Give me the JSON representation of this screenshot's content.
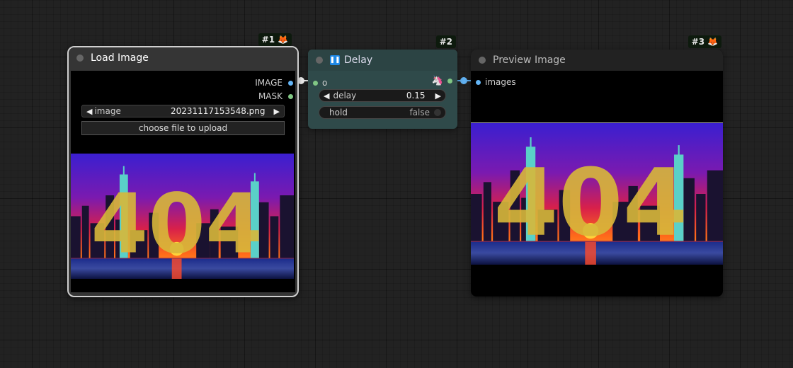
{
  "nodes": {
    "load_image": {
      "id": "#1",
      "title": "Load Image",
      "outputs": [
        "IMAGE",
        "MASK"
      ],
      "image_widget": {
        "label": "image",
        "value": "20231117153548.png"
      },
      "upload_button": "choose file to upload"
    },
    "delay": {
      "id": "#2",
      "title": "Delay",
      "input": "o",
      "delay_widget": {
        "label": "delay",
        "value": "0.15"
      },
      "hold_widget": {
        "label": "hold",
        "value": "false"
      }
    },
    "preview_image": {
      "id": "#3",
      "title": "Preview Image",
      "input": "images"
    }
  },
  "image_text": "404",
  "colors": {
    "image_slot": "#64b5f6",
    "mask_slot": "#81c784",
    "delay_node_bg": "#2f4a4a",
    "node_bg": "#353535",
    "node_header": "#222222",
    "selected_outline": "#cfcfcf"
  },
  "icons": {
    "fox_badge": "fox-icon",
    "pause": "pause-icon",
    "unicorn": "unicorn-icon"
  }
}
